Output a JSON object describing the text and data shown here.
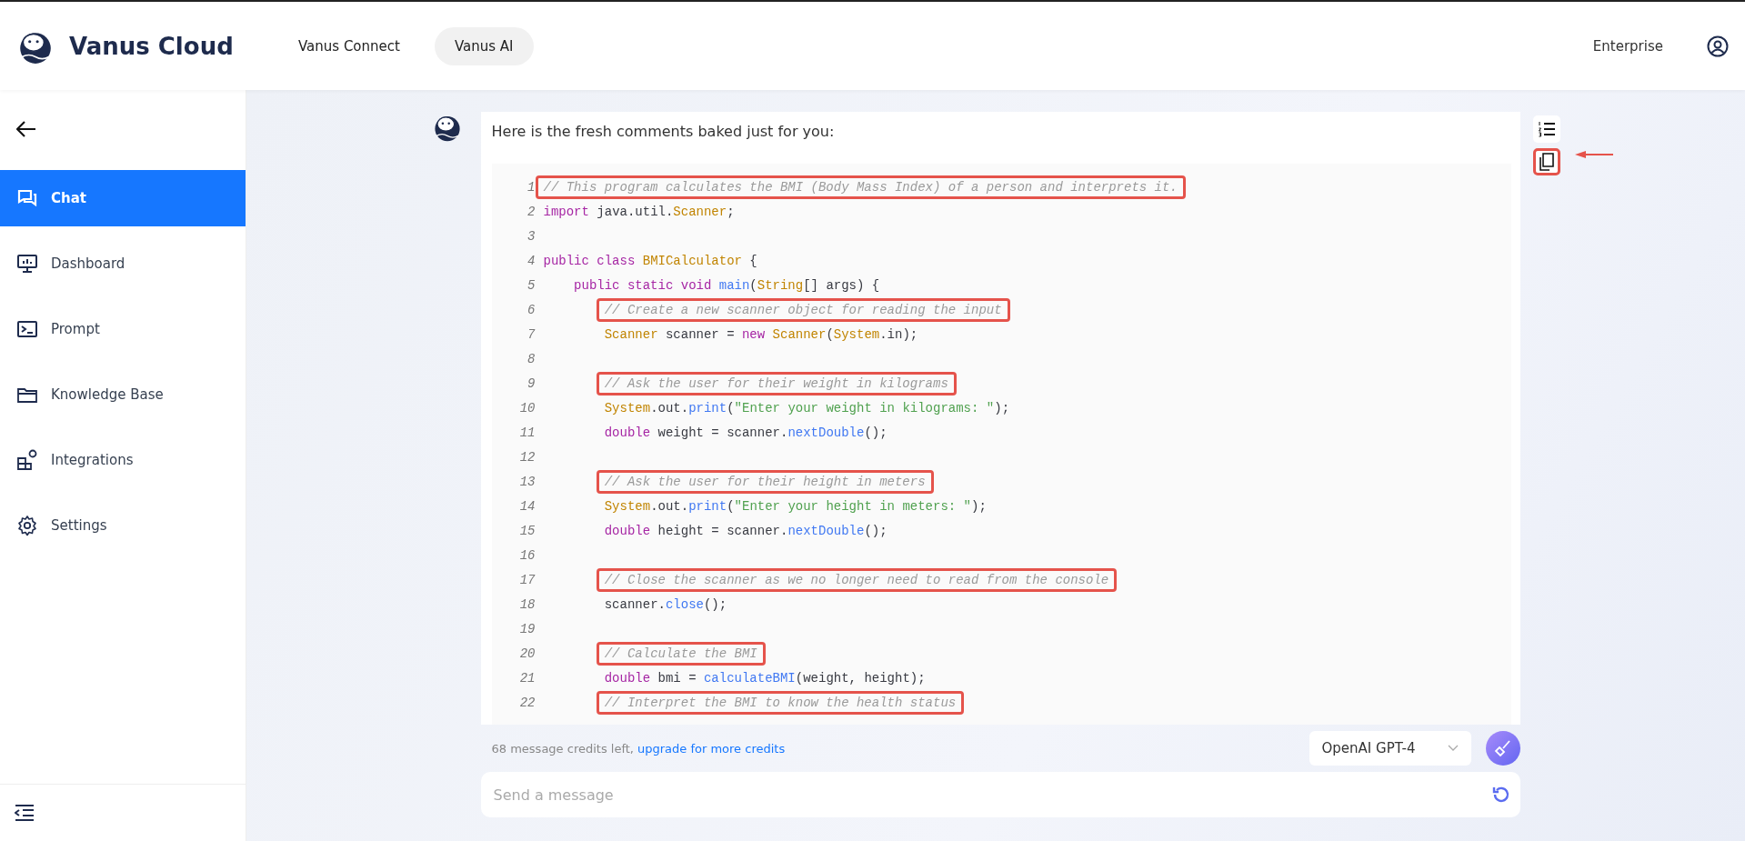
{
  "brand": {
    "name": "Vanus Cloud"
  },
  "top_nav": [
    {
      "label": "Vanus Connect",
      "selected": false
    },
    {
      "label": "Vanus AI",
      "selected": true
    }
  ],
  "header_right": {
    "label": "Enterprise"
  },
  "sidebar": {
    "items": [
      {
        "label": "Chat",
        "selected": true
      },
      {
        "label": "Dashboard",
        "selected": false
      },
      {
        "label": "Prompt",
        "selected": false
      },
      {
        "label": "Knowledge Base",
        "selected": false
      },
      {
        "label": "Integrations",
        "selected": false
      },
      {
        "label": "Settings",
        "selected": false
      }
    ]
  },
  "message": {
    "text": "Here is the fresh comments baked just for you:",
    "copy_highlighted": true,
    "code_lines": [
      {
        "n": "1",
        "highlighted": true,
        "tokens": [
          {
            "kind": "comment",
            "text": "// This program calculates the BMI (Body Mass Index) of a person and interprets it."
          }
        ]
      },
      {
        "n": "2",
        "highlighted": false,
        "tokens": [
          {
            "kind": "kw",
            "text": "import"
          },
          {
            "kind": "plain",
            "text": " java.util."
          },
          {
            "kind": "type",
            "text": "Scanner"
          },
          {
            "kind": "plain",
            "text": ";"
          }
        ]
      },
      {
        "n": "3",
        "highlighted": false
      },
      {
        "n": "4",
        "highlighted": false,
        "tokens": [
          {
            "kind": "kw",
            "text": "public class"
          },
          {
            "kind": "type",
            "text": " BMICalculator"
          },
          {
            "kind": "plain",
            "text": " {"
          }
        ]
      },
      {
        "n": "5",
        "highlighted": false,
        "tokens": [
          {
            "kind": "kw",
            "text": "    public static void"
          },
          {
            "kind": "fn",
            "text": " main"
          },
          {
            "kind": "plain",
            "text": "("
          },
          {
            "kind": "type",
            "text": "String"
          },
          {
            "kind": "plain",
            "text": "[] args) {"
          }
        ]
      },
      {
        "n": "6",
        "highlighted": true,
        "tokens": [
          {
            "kind": "comment",
            "text": "        // Create a new scanner object for reading the input"
          }
        ]
      },
      {
        "n": "7",
        "highlighted": false,
        "tokens": [
          {
            "kind": "type",
            "text": "        Scanner"
          },
          {
            "kind": "plain",
            "text": " scanner = "
          },
          {
            "kind": "kw",
            "text": "new"
          },
          {
            "kind": "type",
            "text": " Scanner"
          },
          {
            "kind": "plain",
            "text": "("
          },
          {
            "kind": "type",
            "text": "System"
          },
          {
            "kind": "plain",
            "text": ".in);"
          }
        ]
      },
      {
        "n": "8",
        "highlighted": false
      },
      {
        "n": "9",
        "highlighted": true,
        "tokens": [
          {
            "kind": "comment",
            "text": "        // Ask the user for their weight in kilograms"
          }
        ]
      },
      {
        "n": "10",
        "highlighted": false,
        "tokens": [
          {
            "kind": "type",
            "text": "        System"
          },
          {
            "kind": "plain",
            "text": ".out."
          },
          {
            "kind": "fn",
            "text": "print"
          },
          {
            "kind": "plain",
            "text": "("
          },
          {
            "kind": "str",
            "text": "\"Enter your weight in kilograms: \""
          },
          {
            "kind": "plain",
            "text": ");"
          }
        ]
      },
      {
        "n": "11",
        "highlighted": false,
        "tokens": [
          {
            "kind": "kw",
            "text": "        double"
          },
          {
            "kind": "plain",
            "text": " weight = scanner."
          },
          {
            "kind": "fn",
            "text": "nextDouble"
          },
          {
            "kind": "plain",
            "text": "();"
          }
        ]
      },
      {
        "n": "12",
        "highlighted": false
      },
      {
        "n": "13",
        "highlighted": true,
        "tokens": [
          {
            "kind": "comment",
            "text": "        // Ask the user for their height in meters"
          }
        ]
      },
      {
        "n": "14",
        "highlighted": false,
        "tokens": [
          {
            "kind": "type",
            "text": "        System"
          },
          {
            "kind": "plain",
            "text": ".out."
          },
          {
            "kind": "fn",
            "text": "print"
          },
          {
            "kind": "plain",
            "text": "("
          },
          {
            "kind": "str",
            "text": "\"Enter your height in meters: \""
          },
          {
            "kind": "plain",
            "text": ");"
          }
        ]
      },
      {
        "n": "15",
        "highlighted": false,
        "tokens": [
          {
            "kind": "kw",
            "text": "        double"
          },
          {
            "kind": "plain",
            "text": " height = scanner."
          },
          {
            "kind": "fn",
            "text": "nextDouble"
          },
          {
            "kind": "plain",
            "text": "();"
          }
        ]
      },
      {
        "n": "16",
        "highlighted": false
      },
      {
        "n": "17",
        "highlighted": true,
        "tokens": [
          {
            "kind": "comment",
            "text": "        // Close the scanner as we no longer need to read from the console"
          }
        ]
      },
      {
        "n": "18",
        "highlighted": false,
        "tokens": [
          {
            "kind": "plain",
            "text": "        scanner."
          },
          {
            "kind": "fn",
            "text": "close"
          },
          {
            "kind": "plain",
            "text": "();"
          }
        ]
      },
      {
        "n": "19",
        "highlighted": false
      },
      {
        "n": "20",
        "highlighted": true,
        "tokens": [
          {
            "kind": "comment",
            "text": "        // Calculate the BMI"
          }
        ]
      },
      {
        "n": "21",
        "highlighted": false,
        "tokens": [
          {
            "kind": "kw",
            "text": "        double"
          },
          {
            "kind": "plain",
            "text": " bmi = "
          },
          {
            "kind": "fn",
            "text": "calculateBMI"
          },
          {
            "kind": "plain",
            "text": "(weight, height);"
          }
        ]
      },
      {
        "n": "22",
        "highlighted": true,
        "tokens": [
          {
            "kind": "comment",
            "text": "        // Interpret the BMI to know the health status"
          }
        ]
      }
    ]
  },
  "credits": {
    "text": "68 message credits left,",
    "link": "upgrade for more credits"
  },
  "model_select": {
    "value": "OpenAI GPT-4"
  },
  "composer": {
    "placeholder": "Send a message"
  }
}
